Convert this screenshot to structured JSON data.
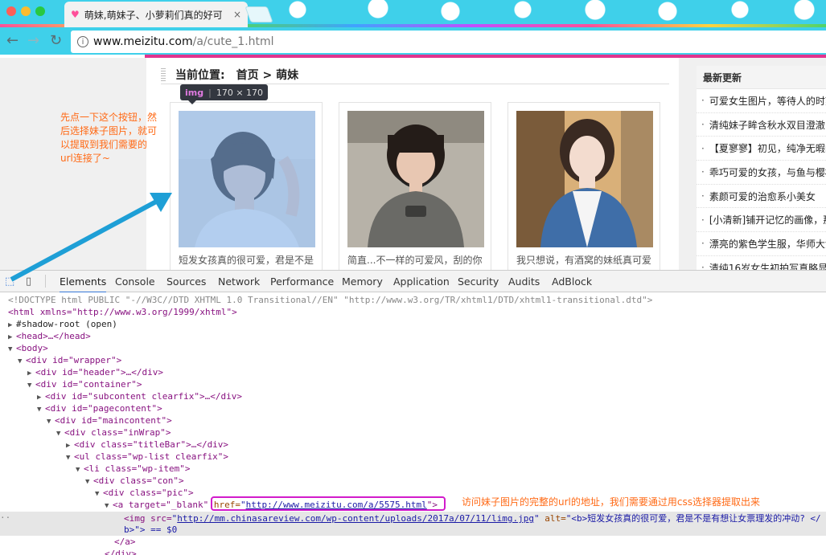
{
  "browser": {
    "tab_title": "萌妹,萌妹子、小萝莉们真的好可",
    "tab_close": "×",
    "url_host": "www.meizitu.com",
    "url_path": "/a/cute_1.html",
    "info_icon": "i",
    "back_icon": "←",
    "forward_icon": "→",
    "reload_icon": "↻"
  },
  "page": {
    "breadcrumb_label": "当前位置:",
    "breadcrumb_path": "首页 > 萌妹",
    "cards": [
      {
        "caption": "短发女孩真的很可爱，君是不是"
      },
      {
        "caption": "简直...不一样的可爱风，刮的你"
      },
      {
        "caption": "我只想说，有酒窝的妹纸真可爱"
      }
    ],
    "sidebar": {
      "title": "最新更新",
      "items": [
        "可爱女生图片，等待人的时刻",
        "清纯妹子眸含秋水双目澄澈",
        "【夏寥寥】初见，纯净无暇的",
        "乖巧可爱的女孩，与鱼与樱桃",
        "素颜可爱的治愈系小美女",
        "[小清新]铺开记忆的画像，那",
        "漂亮的紫色学生服，华师大清",
        "清纯16岁女生初拍写真略显羞"
      ]
    }
  },
  "inspector_tooltip": {
    "tag": "img",
    "size": "170 × 170"
  },
  "annotations": {
    "note_left": "先点一下这个按钮，然后选择妹子图片，就可以提取到我们需要的url连接了~",
    "note_bottom": "访问妹子图片的完整的url的地址，我们需要通过用css选择器提取出来"
  },
  "devtools": {
    "tabs": [
      "Elements",
      "Console",
      "Sources",
      "Network",
      "Performance",
      "Memory",
      "Application",
      "Security",
      "Audits",
      "AdBlock"
    ],
    "active_tab": "Elements",
    "lines": {
      "doctype": "<!DOCTYPE html PUBLIC \"-//W3C//DTD XHTML 1.0 Transitional//EN\" \"http://www.w3.org/TR/xhtml1/DTD/xhtml1-transitional.dtd\">",
      "html_open": "<html xmlns=\"http://www.w3.org/1999/xhtml\">",
      "shadow": "#shadow-root (open)",
      "head": "<head>…</head>",
      "body": "<body>",
      "wrapper": "<div id=\"wrapper\">",
      "header": "<div id=\"header\">…</div>",
      "container": "<div id=\"container\">",
      "subcontent": "<div id=\"subcontent clearfix\">…</div>",
      "pagecontent": "<div id=\"pagecontent\">",
      "maincontent": "<div id=\"maincontent\">",
      "inwrap": "<div class=\"inWrap\">",
      "titlebar": "<div class=\"titleBar\">…</div>",
      "ul": "<ul class=\"wp-list clearfix\">",
      "li": "<li class=\"wp-item\">",
      "con": "<div class=\"con\">",
      "pic": "<div class=\"pic\">",
      "a_open": "<a target=\"_blank\" ",
      "a_href_attr": "href=",
      "a_href_val": "http://www.meizitu.com/a/5575.html",
      "a_close": "\">",
      "img_src_label": "<img src=",
      "img_src_val": "http://mm.chinasareview.com/wp-content/uploads/2017a/07/11/limg.jpg",
      "img_alt_label": " alt=",
      "img_alt_val": "\"<b>短发女孩真的很可爱，君是不是有想让女票理发的冲动? </",
      "img_alt_cont": "b>\"> == $0",
      "a_end": "</a>",
      "div_end": "</div>"
    }
  }
}
